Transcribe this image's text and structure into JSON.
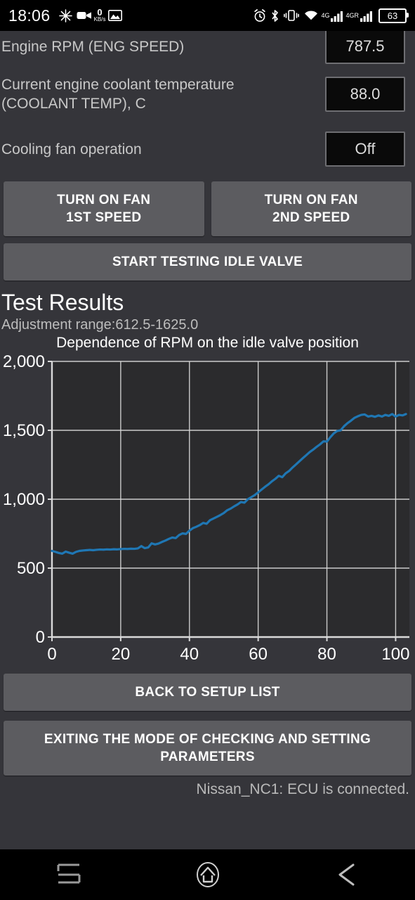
{
  "statusbar": {
    "clock": "18:06",
    "net_speed_value": "0",
    "net_speed_unit": "KB/s",
    "battery_level": "63",
    "net_gen_1": "4G",
    "net_gen_2": "4GR",
    "icons": [
      "burst-icon",
      "video-camera-icon",
      "image-icon",
      "alarm-clock-icon",
      "bluetooth-icon",
      "vibrate-icon",
      "wifi-icon",
      "signal-bars-icon",
      "battery-icon"
    ]
  },
  "params": [
    {
      "label": "Engine RPM (ENG SPEED)",
      "value": "787.5"
    },
    {
      "label": "Current engine coolant temperature (COOLANT TEMP), C",
      "value": "88.0"
    },
    {
      "label": "Cooling fan operation",
      "value": "Off"
    }
  ],
  "buttons": {
    "fan1": "TURN ON FAN\n1ST SPEED",
    "fan1_line1": "TURN ON FAN",
    "fan1_line2": "1ST SPEED",
    "fan2_line1": "TURN ON FAN",
    "fan2_line2": "2ND SPEED",
    "start_test": "START TESTING IDLE VALVE",
    "back_to_setup": "BACK TO SETUP LIST",
    "exit_line1": "EXITING THE MODE OF CHECKING AND SETTING",
    "exit_line2": "PARAMETERS"
  },
  "results": {
    "heading": "Test Results",
    "adjustment_range": "Adjustment range:612.5-1625.0"
  },
  "status_line": "Nissan_NC1: ECU is connected.",
  "colors": {
    "background": "#35353a",
    "plot_background": "#2b2b2d",
    "line": "#1f77b4",
    "button": "#5c5c60",
    "grid": "#d9d9d9"
  },
  "chart_data": {
    "type": "line",
    "title": "Dependence of RPM on the idle valve position",
    "xlabel": "",
    "ylabel": "",
    "xlim": [
      0,
      104
    ],
    "ylim": [
      0,
      2000
    ],
    "xticks": [
      0,
      20,
      40,
      60,
      80,
      100
    ],
    "yticks": [
      0,
      500,
      1000,
      1500,
      2000
    ],
    "grid": true,
    "legend": "none",
    "series": [
      {
        "name": "RPM",
        "x": [
          0,
          1,
          2,
          3,
          4,
          5,
          6,
          7,
          8,
          9,
          10,
          11,
          12,
          13,
          14,
          15,
          16,
          17,
          18,
          19,
          20,
          21,
          22,
          23,
          24,
          25,
          26,
          27,
          28,
          29,
          30,
          31,
          32,
          33,
          34,
          35,
          36,
          37,
          38,
          39,
          40,
          41,
          42,
          43,
          44,
          45,
          46,
          47,
          48,
          49,
          50,
          51,
          52,
          53,
          54,
          55,
          56,
          57,
          58,
          59,
          60,
          61,
          62,
          63,
          64,
          65,
          66,
          67,
          68,
          69,
          70,
          71,
          72,
          73,
          74,
          75,
          76,
          77,
          78,
          79,
          80,
          81,
          82,
          83,
          84,
          85,
          86,
          87,
          88,
          89,
          90,
          91,
          92,
          93,
          94,
          95,
          96,
          97,
          98,
          99,
          100,
          101,
          102,
          103
        ],
        "y": [
          625,
          618,
          610,
          605,
          620,
          612,
          605,
          618,
          625,
          628,
          630,
          632,
          630,
          633,
          635,
          634,
          636,
          635,
          637,
          636,
          638,
          640,
          639,
          641,
          640,
          643,
          660,
          645,
          650,
          680,
          672,
          678,
          690,
          700,
          712,
          722,
          718,
          740,
          752,
          748,
          772,
          790,
          800,
          812,
          828,
          822,
          848,
          860,
          872,
          885,
          900,
          920,
          932,
          948,
          962,
          980,
          975,
          1000,
          1015,
          1030,
          1050,
          1070,
          1090,
          1108,
          1130,
          1148,
          1170,
          1160,
          1188,
          1205,
          1230,
          1252,
          1275,
          1298,
          1320,
          1342,
          1360,
          1380,
          1398,
          1420,
          1418,
          1450,
          1478,
          1495,
          1500,
          1530,
          1552,
          1570,
          1590,
          1602,
          1612,
          1615,
          1600,
          1605,
          1598,
          1608,
          1600,
          1612,
          1605,
          1618,
          1600,
          1612,
          1608,
          1618,
          1605,
          1620
        ]
      }
    ]
  }
}
